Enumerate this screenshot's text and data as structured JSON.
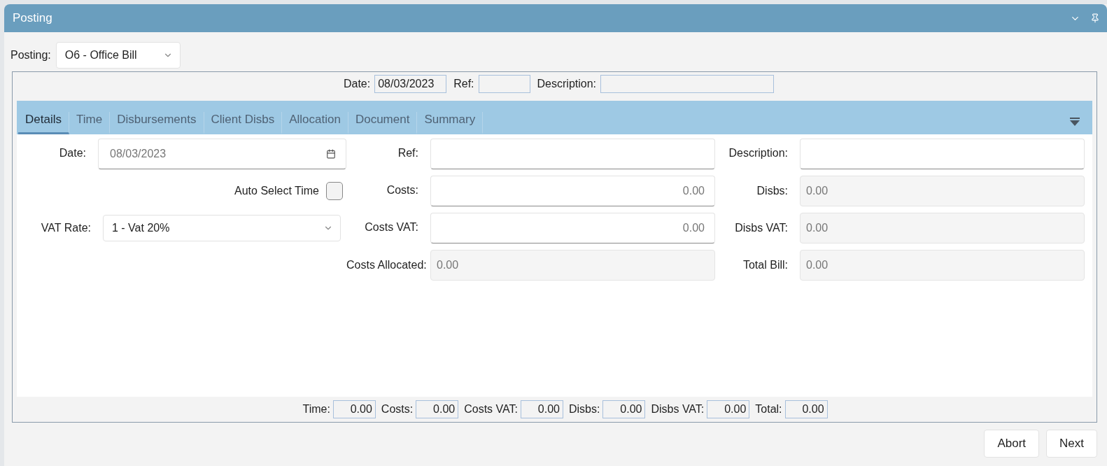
{
  "window": {
    "title": "Posting"
  },
  "posting": {
    "label": "Posting:",
    "value": "O6 - Office Bill"
  },
  "header_fields": [
    {
      "label": "Date:",
      "value": "08/03/2023"
    },
    {
      "label": "Ref:"
    },
    {
      "label": "Description:"
    }
  ],
  "tabs": [
    {
      "label": "Details",
      "selected": true
    },
    {
      "label": "Time",
      "selected": false
    },
    {
      "label": "Disbursements",
      "selected": false
    },
    {
      "label": "Client Disbs",
      "selected": false
    },
    {
      "label": "Allocation",
      "selected": false
    },
    {
      "label": "Document",
      "selected": false
    },
    {
      "label": "Summary",
      "selected": false
    }
  ],
  "columns": [
    {
      "rows": [
        {
          "kind": "date",
          "label": "Date:",
          "value": "08/03/2023"
        },
        {
          "kind": "checkbox",
          "label": "Auto Select Time",
          "checked": false
        },
        {
          "kind": "select",
          "label": "VAT Rate:",
          "value": "1 - Vat 20%"
        }
      ]
    },
    {
      "rows": [
        {
          "kind": "input",
          "label": "Ref:"
        },
        {
          "kind": "input",
          "label": "Costs:",
          "value": "0.00"
        },
        {
          "kind": "input",
          "label": "Costs VAT:",
          "value": "0.00"
        },
        {
          "kind": "readonly",
          "label": "Costs Allocated:",
          "value": "0.00"
        }
      ]
    },
    {
      "rows": [
        {
          "kind": "input",
          "label": "Description:"
        },
        {
          "kind": "readonly",
          "label": "Disbs:",
          "value": "0.00"
        },
        {
          "kind": "readonly",
          "label": "Disbs VAT:",
          "value": "0.00"
        },
        {
          "kind": "readonly",
          "label": "Total Bill:",
          "value": "0.00"
        }
      ]
    }
  ],
  "totals": [
    {
      "label": "Time:",
      "value": "0.00"
    },
    {
      "label": "Costs:",
      "value": "0.00"
    },
    {
      "label": "Costs VAT:",
      "value": "0.00"
    },
    {
      "label": "Disbs:",
      "value": "0.00"
    },
    {
      "label": "Disbs VAT:",
      "value": "0.00"
    },
    {
      "label": "Total:",
      "value": "0.00"
    }
  ],
  "buttons": [
    "Abort",
    "Next"
  ]
}
